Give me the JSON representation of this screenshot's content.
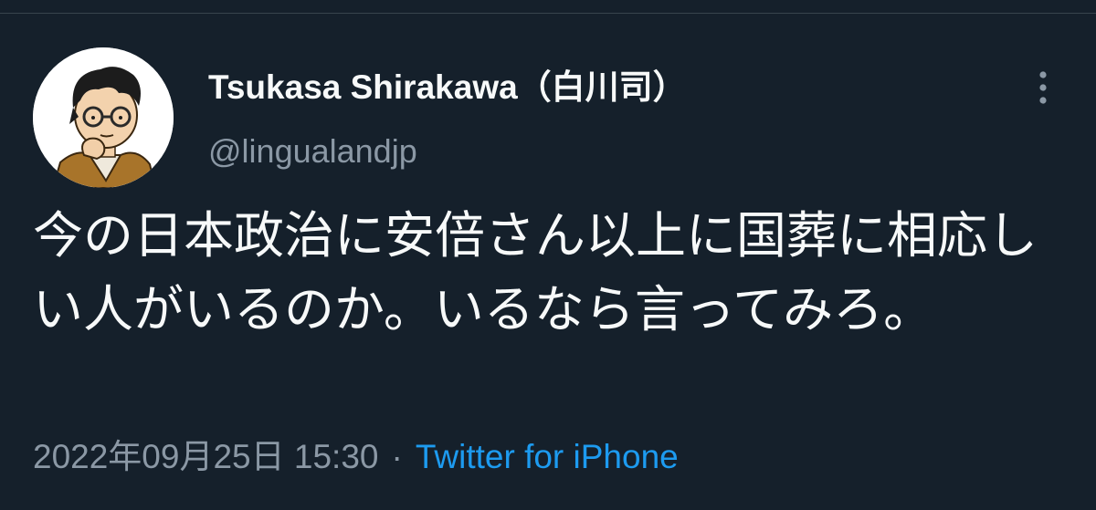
{
  "tweet": {
    "author": {
      "display_name": "Tsukasa Shirakawa（白川司）",
      "handle": "@lingualandjp",
      "avatar_icon": "cartoon-man-with-glasses-avatar"
    },
    "more_icon": "more-vertical-icon",
    "text": "今の日本政治に安倍さん以上に国葬に相応しい人がいるのか。いるなら言ってみろ。",
    "timestamp": "2022年09月25日 15:30",
    "separator": "·",
    "source": "Twitter for iPhone"
  },
  "colors": {
    "background": "#15202b",
    "primary_text": "#f7f9f9",
    "secondary_text": "#8b98a5",
    "link": "#1d9bf0",
    "divider": "#38444d"
  }
}
